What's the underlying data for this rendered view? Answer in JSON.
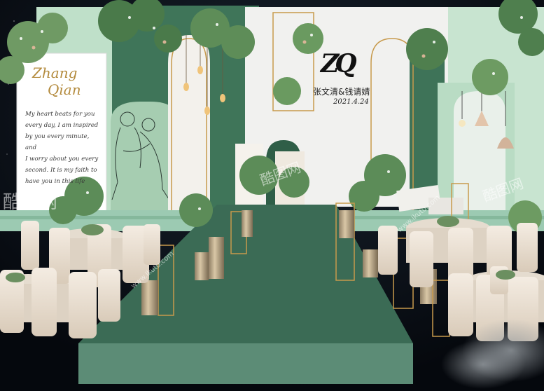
{
  "sign": {
    "title_line1": "Zhang",
    "title_line2": "Qian",
    "body_lines": [
      "My heart beats for you",
      "every day, I am inspired",
      "by you every minute, and",
      "I worry about you every",
      "second. It is my faith to",
      "have you in this life"
    ]
  },
  "backdrop": {
    "monogram": "ZQ",
    "names": "张文清&钱请婧",
    "date": "2021.4.24"
  },
  "watermark": {
    "text": "酷图网",
    "url": "www.ikutu.com"
  },
  "colors": {
    "sage": "#b9dcc4",
    "deep_green": "#3e7258",
    "aisle": "#3b6b55",
    "chair": "#eadfd2",
    "gold": "#c79a4c"
  }
}
